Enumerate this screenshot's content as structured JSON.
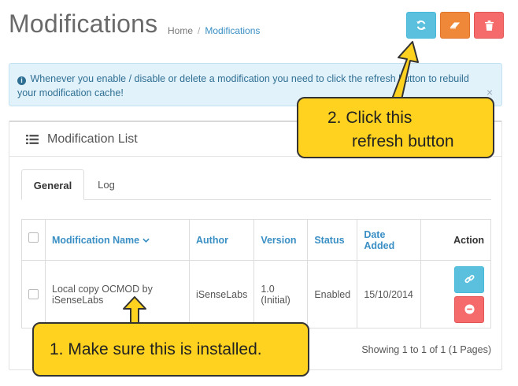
{
  "page": {
    "title": "Modifications",
    "breadcrumb": [
      "Home",
      "Modifications"
    ]
  },
  "toolbar": {
    "refresh_icon": "refresh-icon",
    "clear_icon": "eraser-icon",
    "delete_icon": "trash-icon",
    "colors": {
      "refresh": "#5bc0de",
      "clear": "#f0883a",
      "delete": "#f56b6b"
    }
  },
  "alert": {
    "text": "Whenever you enable / disable or delete a modification you need to click the refresh button to rebuild your modification cache!",
    "close": "×"
  },
  "panel": {
    "title": "Modification List",
    "tabs": [
      {
        "label": "General",
        "active": true
      },
      {
        "label": "Log",
        "active": false
      }
    ]
  },
  "table": {
    "headers": {
      "name": "Modification Name",
      "author": "Author",
      "version": "Version",
      "status": "Status",
      "date_added": "Date Added",
      "action": "Action"
    },
    "rows": [
      {
        "name": "Local copy OCMOD by iSenseLabs",
        "author": "iSenseLabs",
        "version": "1.0 (Initial)",
        "status": "Enabled",
        "date_added": "15/10/2014"
      }
    ]
  },
  "pagination": {
    "summary": "Showing 1 to 1 of 1 (1 Pages)"
  },
  "callouts": {
    "one": "1.  Make sure this is installed.",
    "two_line1": "2.  Click this",
    "two_line2": "refresh button",
    "color": "#ffd21f"
  }
}
